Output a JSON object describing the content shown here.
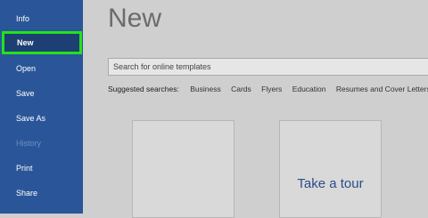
{
  "sidebar": {
    "items": [
      {
        "label": "Info"
      },
      {
        "label": "New"
      },
      {
        "label": "Open"
      },
      {
        "label": "Save"
      },
      {
        "label": "Save As"
      },
      {
        "label": "History"
      },
      {
        "label": "Print"
      },
      {
        "label": "Share"
      }
    ]
  },
  "main": {
    "title": "New",
    "search_placeholder": "Search for online templates",
    "suggested_label": "Suggested searches:",
    "suggested": [
      "Business",
      "Cards",
      "Flyers",
      "Education",
      "Resumes and Cover Letters"
    ],
    "templates": [
      {
        "label": ""
      },
      {
        "label": "Take a tour"
      }
    ]
  },
  "colors": {
    "sidebar_bg": "#2a5699",
    "highlight": "#22e31a",
    "accent_text": "#2b4c8a"
  }
}
